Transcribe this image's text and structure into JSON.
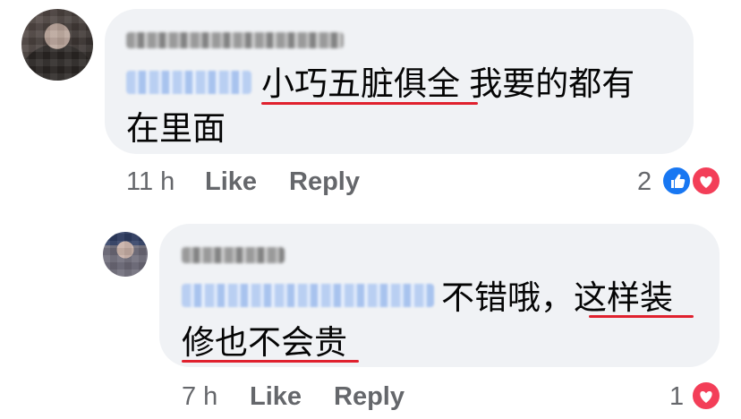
{
  "comments": [
    {
      "author": "Kimberly Moody",
      "mention": "Kai Wee",
      "text_line1": "小巧五脏俱全 我要的都有",
      "text_line2": "在里面",
      "time": "11 h",
      "like_label": "Like",
      "reply_label": "Reply",
      "reaction_count": "2",
      "reactions": [
        "like-icon",
        "love-icon"
      ]
    },
    {
      "author": "Kai Wee",
      "mention": "Kimberly Moody",
      "text_line1": "不错哦，这样装",
      "text_line2": "修也不会贵",
      "time": "7 h",
      "like_label": "Like",
      "reply_label": "Reply",
      "reaction_count": "1",
      "reactions": [
        "love-icon"
      ]
    }
  ],
  "colors": {
    "bubble": "#f0f2f5",
    "meta_text": "#65676b",
    "underline": "#e0212e",
    "like_blue": "#1877f2",
    "love_red": "#f33e58"
  }
}
